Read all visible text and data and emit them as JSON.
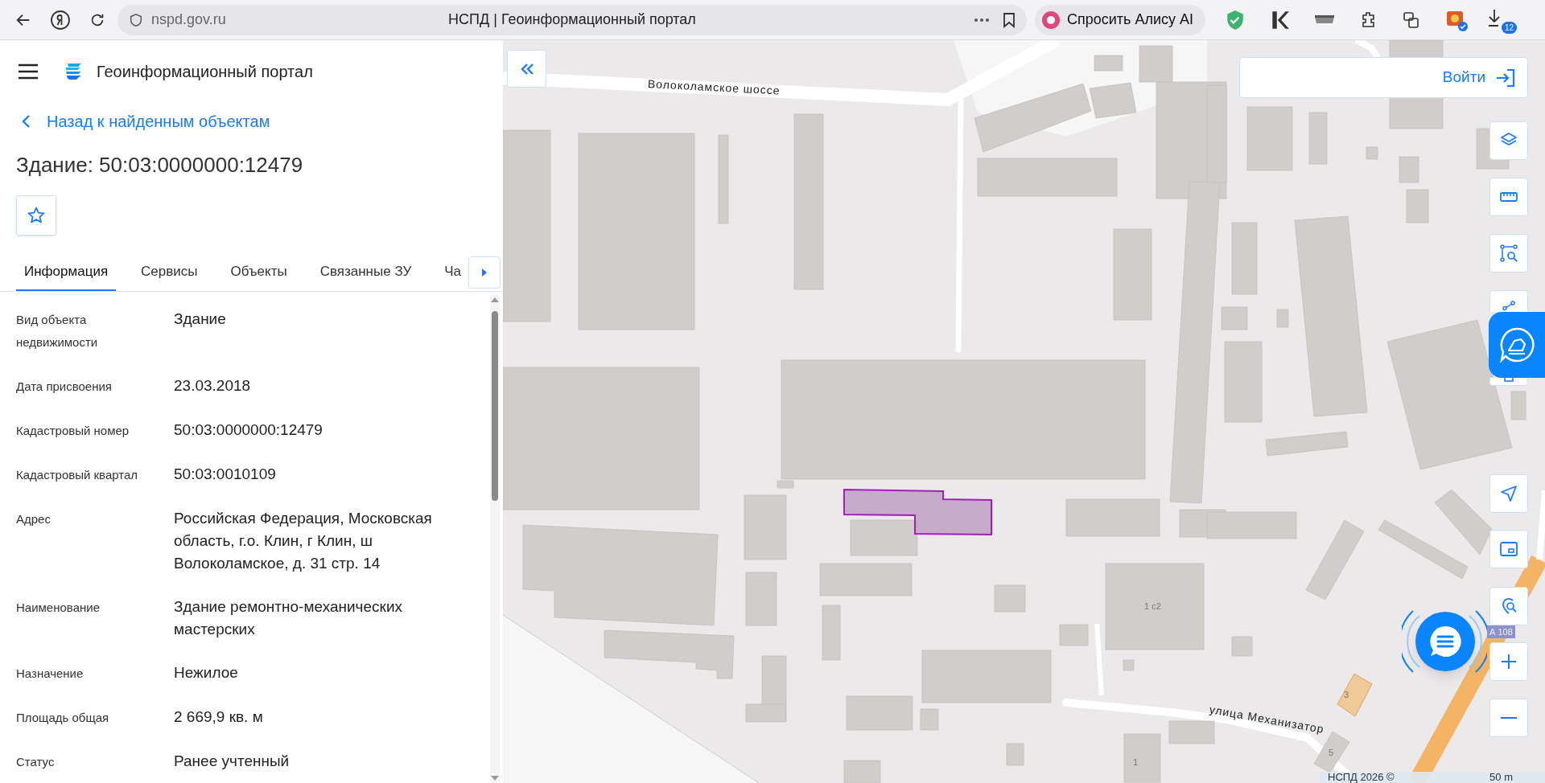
{
  "browser": {
    "address": "nspd.gov.ru",
    "page_title": "НСПД | Геоинформационный портал",
    "assistant": "Спросить Алису AI",
    "downloads_badge": "12"
  },
  "panel": {
    "app_title": "Геоинформационный портал",
    "back_link": "Назад к найденным объектам",
    "heading": "Здание: 50:03:0000000:12479",
    "tabs": [
      {
        "label": "Информация",
        "selected": true
      },
      {
        "label": "Сервисы",
        "selected": false
      },
      {
        "label": "Объекты",
        "selected": false
      },
      {
        "label": "Связанные ЗУ",
        "selected": false
      },
      {
        "label": "Ча",
        "selected": false
      }
    ],
    "fields": [
      {
        "label": "Вид объекта недвижимости",
        "value": "Здание"
      },
      {
        "label": "Дата присвоения",
        "value": "23.03.2018"
      },
      {
        "label": "Кадастровый номер",
        "value": "50:03:0000000:12479"
      },
      {
        "label": "Кадастровый квартал",
        "value": "50:03:0010109"
      },
      {
        "label": "Адрес",
        "value": "Российская Федерация, Московская область, г.о. Клин, г Клин, ш Волоколамское, д. 31 стр. 14"
      },
      {
        "label": "Наименование",
        "value": "Здание ремонтно-механических мастерских"
      },
      {
        "label": "Назначение",
        "value": "Нежилое"
      },
      {
        "label": "Площадь общая",
        "value": "2 669,9 кв. м"
      },
      {
        "label": "Статус",
        "value": "Ранее учтенный"
      }
    ]
  },
  "map": {
    "login": "Войти",
    "labels": [
      {
        "kind": "street",
        "text": "Волоколамское шоссе"
      },
      {
        "kind": "street",
        "text": "улица Механизатор"
      },
      {
        "kind": "house",
        "text": "1 с2"
      },
      {
        "kind": "house",
        "text": "1"
      },
      {
        "kind": "house",
        "text": "3"
      },
      {
        "kind": "house",
        "text": "5"
      },
      {
        "kind": "route",
        "text": "А 108"
      }
    ],
    "attribution": "НСПД 2026 ©",
    "scale": "50 m"
  }
}
